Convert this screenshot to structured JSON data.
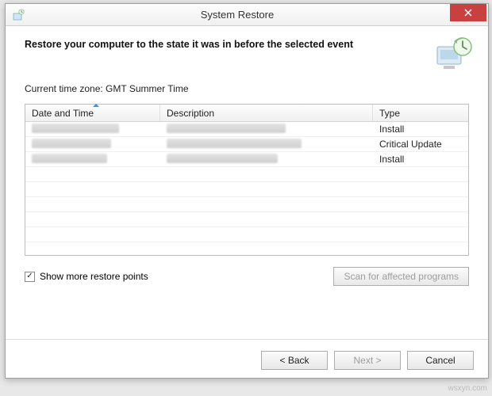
{
  "window": {
    "title": "System Restore"
  },
  "headline": "Restore your computer to the state it was in before the selected event",
  "timezone_label": "Current time zone: GMT Summer Time",
  "table": {
    "columns": {
      "date_time": "Date and Time",
      "description": "Description",
      "type": "Type"
    },
    "rows": [
      {
        "type": "Install"
      },
      {
        "type": "Critical Update"
      },
      {
        "type": "Install"
      }
    ]
  },
  "show_more": {
    "checked": true,
    "label": "Show more restore points"
  },
  "buttons": {
    "scan": "Scan for affected programs",
    "back": "< Back",
    "next": "Next >",
    "cancel": "Cancel"
  },
  "watermark": "wsxyn.com"
}
